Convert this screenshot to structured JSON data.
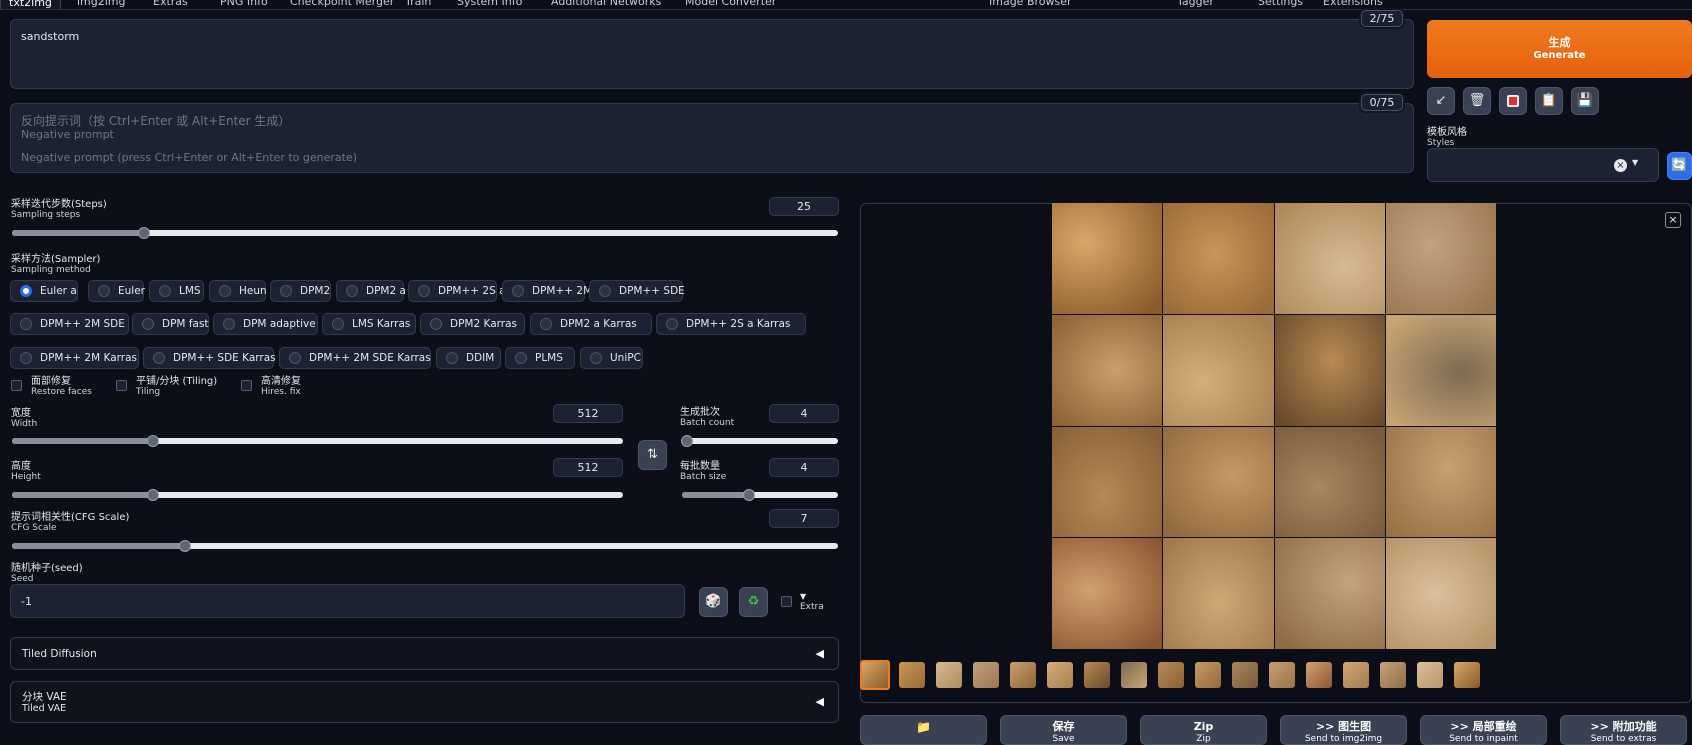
{
  "tabs": [
    "txt2img",
    "img2img",
    "Extras",
    "PNG Info",
    "Checkpoint Merger",
    "Train",
    "System Info",
    "Additional Networks",
    "Model Converter",
    "Image Browser",
    "Tagger",
    "Settings",
    "Extensions"
  ],
  "prompt": {
    "value": "sandstorm",
    "counter": "2/75"
  },
  "negative": {
    "counter": "0/75",
    "ph_cn": "反向提示词（按 Ctrl+Enter 或 Alt+Enter 生成）",
    "ph_en1": "Negative prompt",
    "ph_en2": "Negative prompt (press Ctrl+Enter or Alt+Enter to generate)"
  },
  "generate": {
    "cn": "生成",
    "en": "Generate"
  },
  "styles": {
    "cn": "模板风格",
    "en": "Styles"
  },
  "steps": {
    "cn": "采样迭代步数(Steps)",
    "en": "Sampling steps",
    "value": "25",
    "level": 0.16
  },
  "sampler": {
    "cn": "采样方法(Sampler)",
    "en": "Sampling method",
    "selected": "Euler a",
    "options": [
      "Euler a",
      "Euler",
      "LMS",
      "Heun",
      "DPM2",
      "DPM2 a",
      "DPM++ 2S a",
      "DPM++ 2M",
      "DPM++ SDE",
      "DPM++ 2M SDE",
      "DPM fast",
      "DPM adaptive",
      "LMS Karras",
      "DPM2 Karras",
      "DPM2 a Karras",
      "DPM++ 2S a Karras",
      "DPM++ 2M Karras",
      "DPM++ SDE Karras",
      "DPM++ 2M SDE Karras",
      "DDIM",
      "PLMS",
      "UniPC"
    ]
  },
  "checks": [
    {
      "cn": "面部修复",
      "en": "Restore faces"
    },
    {
      "cn": "平铺/分块 (Tiling)",
      "en": "Tiling"
    },
    {
      "cn": "高清修复",
      "en": "Hires. fix"
    }
  ],
  "width": {
    "cn": "宽度",
    "en": "Width",
    "value": "512",
    "level": 0.23
  },
  "height": {
    "cn": "高度",
    "en": "Height",
    "value": "512",
    "level": 0.23
  },
  "batch_count": {
    "cn": "生成批次",
    "en": "Batch count",
    "value": "4",
    "level": 0.03
  },
  "batch_size": {
    "cn": "每批数量",
    "en": "Batch size",
    "value": "4",
    "level": 0.43
  },
  "cfg": {
    "cn": "提示词相关性(CFG Scale)",
    "en": "CFG Scale",
    "value": "7",
    "level": 0.21
  },
  "seed": {
    "cn": "随机种子(seed)",
    "en": "Seed",
    "value": "-1",
    "extra": "Extra"
  },
  "accordions": [
    {
      "title": "Tiled Diffusion"
    },
    {
      "title_cn": "分块 VAE",
      "title_en": "Tiled VAE"
    }
  ],
  "actions": [
    {
      "cn": "",
      "en": ""
    },
    {
      "cn": "保存",
      "en": "Save"
    },
    {
      "cn": "Zip",
      "en": "Zip"
    },
    {
      "cn": ">> 图生图",
      "en": "Send to img2img"
    },
    {
      "cn": ">> 局部重绘",
      "en": "Send to inpaint"
    },
    {
      "cn": ">> 附加功能",
      "en": "Send to extras"
    }
  ],
  "colors": {
    "accent": "#e5620e",
    "panel": "#1c2232",
    "bg": "#0c0f18",
    "selected_radio": "#2f6bea"
  }
}
